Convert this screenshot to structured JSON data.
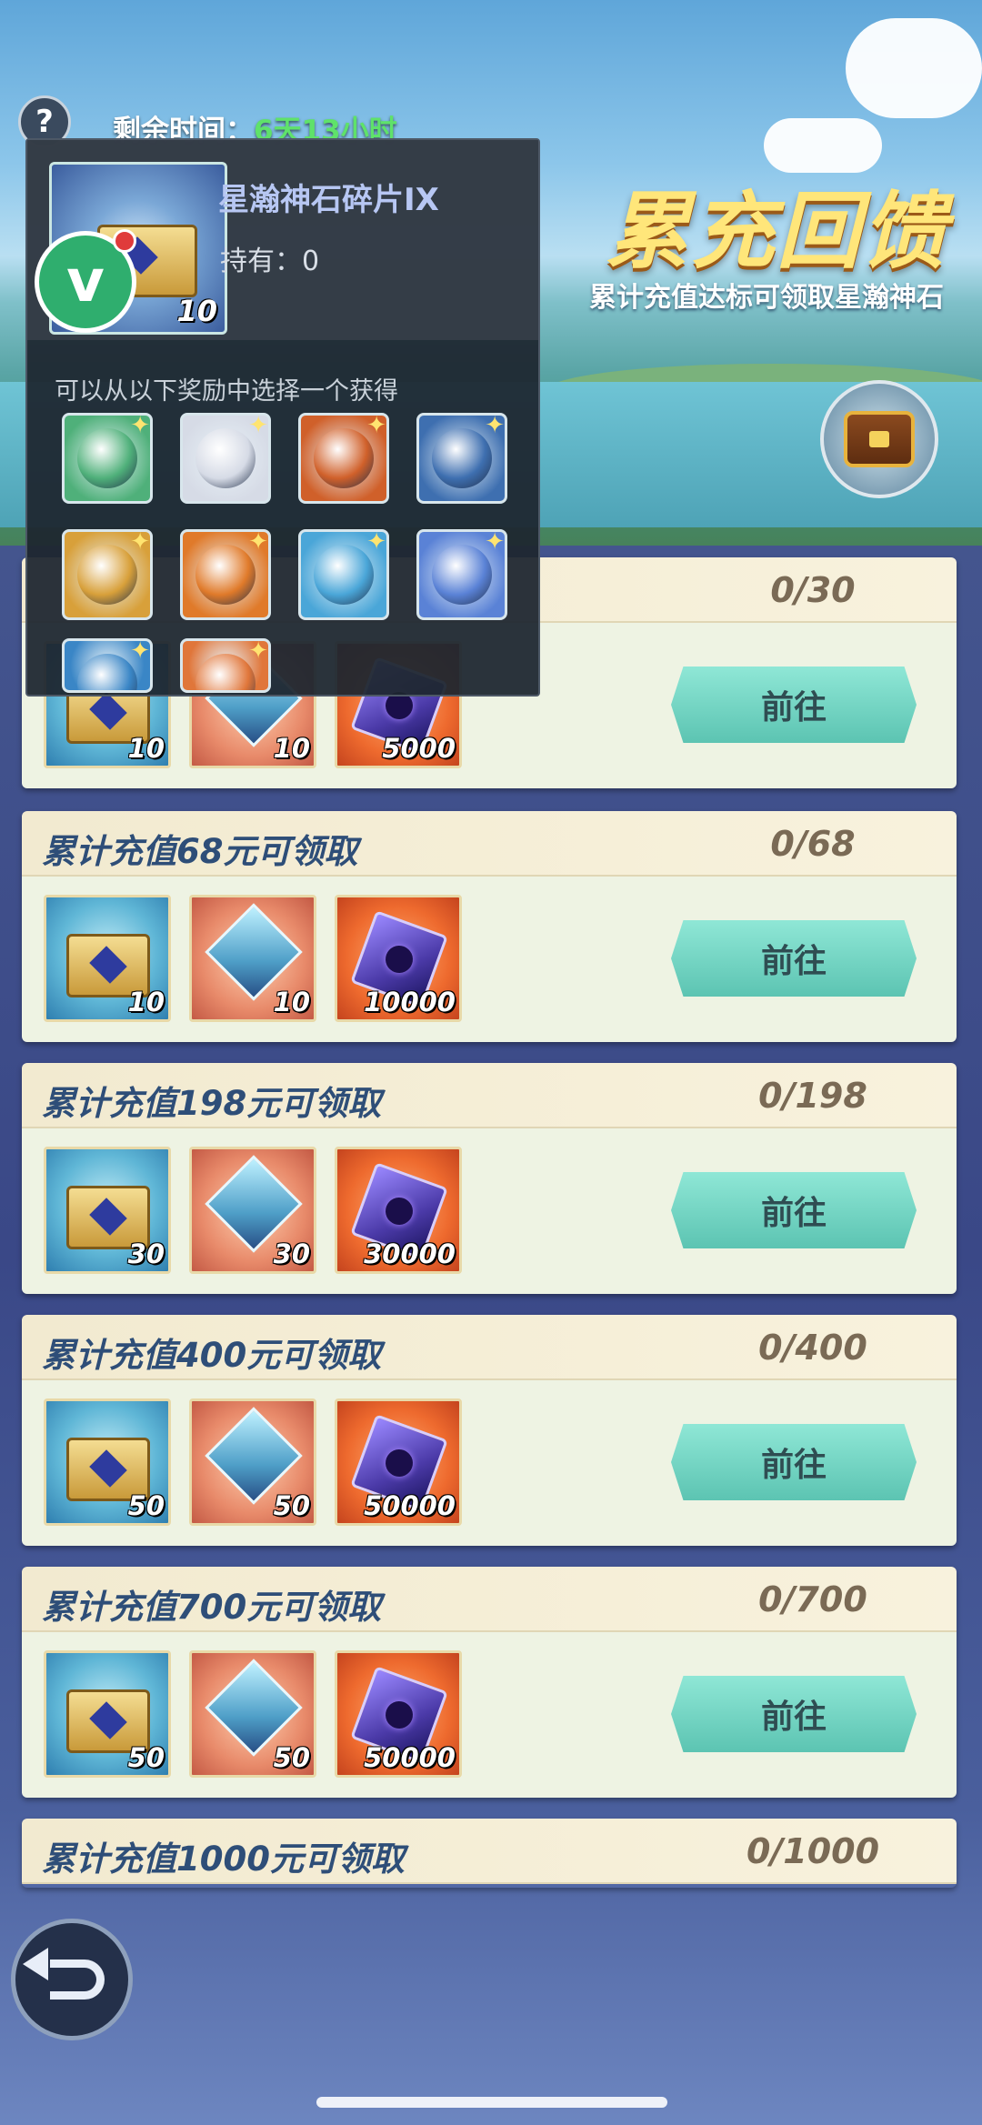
{
  "timer": {
    "label": "剩余时间：",
    "value": "6天13小时"
  },
  "help_glyph": "?",
  "banner": {
    "title": "累充回馈",
    "subtitle": "累计充值达标可领取星瀚神石"
  },
  "goto_label": "前往",
  "rows": [
    {
      "label": "",
      "progress": "0/30",
      "counts": [
        "10",
        "10",
        "5000"
      ]
    },
    {
      "label": "累计充值68元可领取",
      "progress": "0/68",
      "counts": [
        "10",
        "10",
        "10000"
      ]
    },
    {
      "label": "累计充值198元可领取",
      "progress": "0/198",
      "counts": [
        "30",
        "30",
        "30000"
      ]
    },
    {
      "label": "累计充值400元可领取",
      "progress": "0/400",
      "counts": [
        "50",
        "50",
        "50000"
      ]
    },
    {
      "label": "累计充值700元可领取",
      "progress": "0/700",
      "counts": [
        "50",
        "50",
        "50000"
      ]
    },
    {
      "label": "累计充值1000元可领取",
      "progress": "0/1000",
      "counts": []
    }
  ],
  "popup": {
    "item_name": "星瀚神石碎片IX",
    "owned": "持有：0",
    "item_count": "10",
    "description": "可以从以下奖励中选择一个获得",
    "logo_letter": "v",
    "options": [
      {
        "icon": "green-ring-icon",
        "color": "#4fb07a"
      },
      {
        "icon": "white-orb-icon",
        "color": "#d6dbe6"
      },
      {
        "icon": "fire-skull-icon",
        "color": "#d0602a"
      },
      {
        "icon": "blue-ring-icon",
        "color": "#3e6fb0"
      },
      {
        "icon": "gold-moon-icon",
        "color": "#d8a03a"
      },
      {
        "icon": "sun-orb-icon",
        "color": "#e07a2a"
      },
      {
        "icon": "blue-eye-icon",
        "color": "#4aa6d8"
      },
      {
        "icon": "star-burst-icon",
        "color": "#5a82d6"
      },
      {
        "icon": "blue-swirl-icon",
        "color": "#3a86c6"
      },
      {
        "icon": "orange-orb-icon",
        "color": "#e0763a"
      }
    ],
    "option_star": "✦"
  }
}
